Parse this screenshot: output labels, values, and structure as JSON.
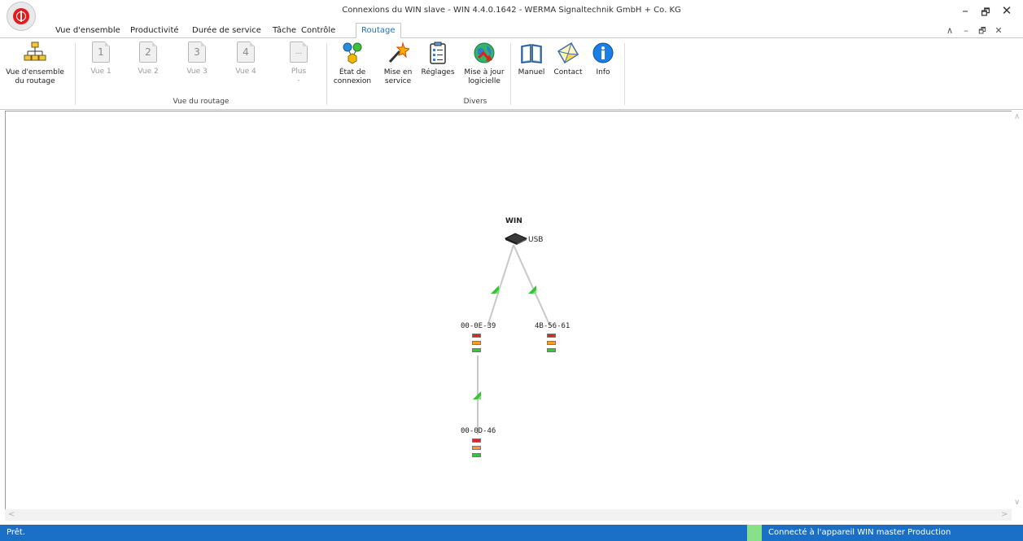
{
  "window": {
    "title": "Connexions du WIN slave - WIN 4.4.0.1642 - WERMA Signaltechnik GmbH + Co. KG",
    "minimize": "–",
    "restore": "🗗",
    "close": "✕"
  },
  "mdi": {
    "up": "∧",
    "minimize": "–",
    "restore": "🗗",
    "close": "✕"
  },
  "tabs": [
    "Vue d'ensemble",
    "Productivité",
    "Durée de service",
    "Tâche",
    "Contrôle",
    "Routage"
  ],
  "ribbon": {
    "overview_label": "Vue d'ensemble du routage",
    "views": [
      {
        "label": "Vue 1",
        "glyph": "1"
      },
      {
        "label": "Vue 2",
        "glyph": "2"
      },
      {
        "label": "Vue 3",
        "glyph": "3"
      },
      {
        "label": "Vue 4",
        "glyph": "4"
      },
      {
        "label": "Plus",
        "glyph": "...",
        "sub": "-"
      }
    ],
    "group_routing": "Vue du routage",
    "connection_state": "État de connexion",
    "commissioning": "Mise en service",
    "settings": "Réglages",
    "update": "Mise à jour logicielle",
    "manual": "Manuel",
    "contact": "Contact",
    "info": "Info",
    "group_misc": "Divers"
  },
  "topology": {
    "root_name": "WIN",
    "root_interface": "USB",
    "nodes": [
      "00-0E-39",
      "4B-56-61",
      "00-0D-46"
    ]
  },
  "status": {
    "left": "Prêt.",
    "right": "Connecté à l'appareil WIN master Production",
    "indicator_color": "#88e088"
  }
}
